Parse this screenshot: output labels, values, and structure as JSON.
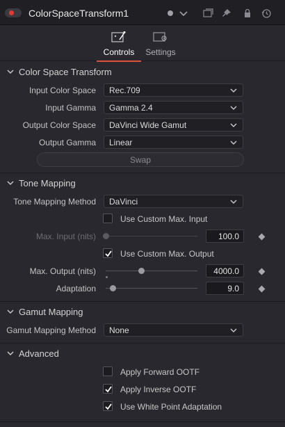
{
  "header": {
    "title": "ColorSpaceTransform1",
    "icons": [
      "toggle-dot-icon",
      "color-dot-icon",
      "chevron-down-icon",
      "window-icon",
      "pin-icon",
      "lock-icon",
      "reset-icon"
    ]
  },
  "tabs": [
    {
      "label": "Controls",
      "icon": "controls-icon",
      "active": true
    },
    {
      "label": "Settings",
      "icon": "settings-icon",
      "active": false
    }
  ],
  "colors": {
    "accent": "#d8523d",
    "bg": "#28282e",
    "field_bg": "#1f1f24"
  },
  "cst": {
    "title": "Color Space Transform",
    "input_color_space": {
      "label": "Input Color Space",
      "value": "Rec.709"
    },
    "input_gamma": {
      "label": "Input Gamma",
      "value": "Gamma 2.4"
    },
    "output_color_space": {
      "label": "Output Color Space",
      "value": "DaVinci Wide Gamut"
    },
    "output_gamma": {
      "label": "Output Gamma",
      "value": "Linear"
    },
    "swap_label": "Swap"
  },
  "tone": {
    "title": "Tone Mapping",
    "method": {
      "label": "Tone Mapping Method",
      "value": "DaVinci"
    },
    "custom_max_input": {
      "label": "Use Custom Max. Input",
      "checked": false
    },
    "max_input": {
      "label": "Max. Input (nits)",
      "value": "100.0",
      "fraction": 0.0
    },
    "custom_max_output": {
      "label": "Use Custom Max. Output",
      "checked": true
    },
    "max_output": {
      "label": "Max. Output (nits)",
      "value": "4000.0",
      "fraction": 0.4
    },
    "adaptation": {
      "label": "Adaptation",
      "value": "9.0",
      "fraction": 0.1
    }
  },
  "gamut": {
    "title": "Gamut Mapping",
    "method": {
      "label": "Gamut Mapping Method",
      "value": "None"
    }
  },
  "advanced": {
    "title": "Advanced",
    "forward_ootf": {
      "label": "Apply Forward OOTF",
      "checked": false
    },
    "inverse_ootf": {
      "label": "Apply Inverse OOTF",
      "checked": true
    },
    "white_point": {
      "label": "Use White Point Adaptation",
      "checked": true
    }
  }
}
